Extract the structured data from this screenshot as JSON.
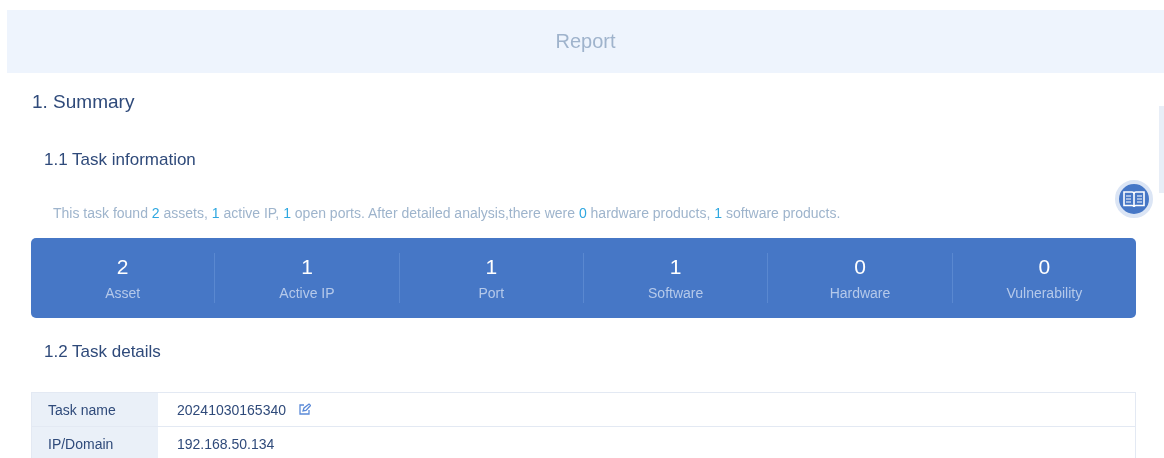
{
  "header": {
    "title": "Report"
  },
  "summary": {
    "heading": "1. Summary",
    "task_information": {
      "heading": "1.1 Task information",
      "sentence": [
        {
          "text": "This task found ",
          "highlight": false
        },
        {
          "text": "2",
          "highlight": true
        },
        {
          "text": " assets, ",
          "highlight": false
        },
        {
          "text": "1",
          "highlight": true
        },
        {
          "text": " active IP, ",
          "highlight": false
        },
        {
          "text": "1",
          "highlight": true
        },
        {
          "text": " open ports. After detailed analysis,there were ",
          "highlight": false
        },
        {
          "text": "0",
          "highlight": true
        },
        {
          "text": " hardware products, ",
          "highlight": false
        },
        {
          "text": "1",
          "highlight": true
        },
        {
          "text": " software products.",
          "highlight": false
        }
      ],
      "stats": [
        {
          "value": "2",
          "label": "Asset"
        },
        {
          "value": "1",
          "label": "Active IP"
        },
        {
          "value": "1",
          "label": "Port"
        },
        {
          "value": "1",
          "label": "Software"
        },
        {
          "value": "0",
          "label": "Hardware"
        },
        {
          "value": "0",
          "label": "Vulnerability"
        }
      ]
    },
    "task_details": {
      "heading": "1.2 Task details",
      "rows": [
        {
          "label": "Task name",
          "value": "20241030165340",
          "editable": true
        },
        {
          "label": "IP/Domain",
          "value": "192.168.50.134",
          "editable": false
        }
      ]
    }
  }
}
